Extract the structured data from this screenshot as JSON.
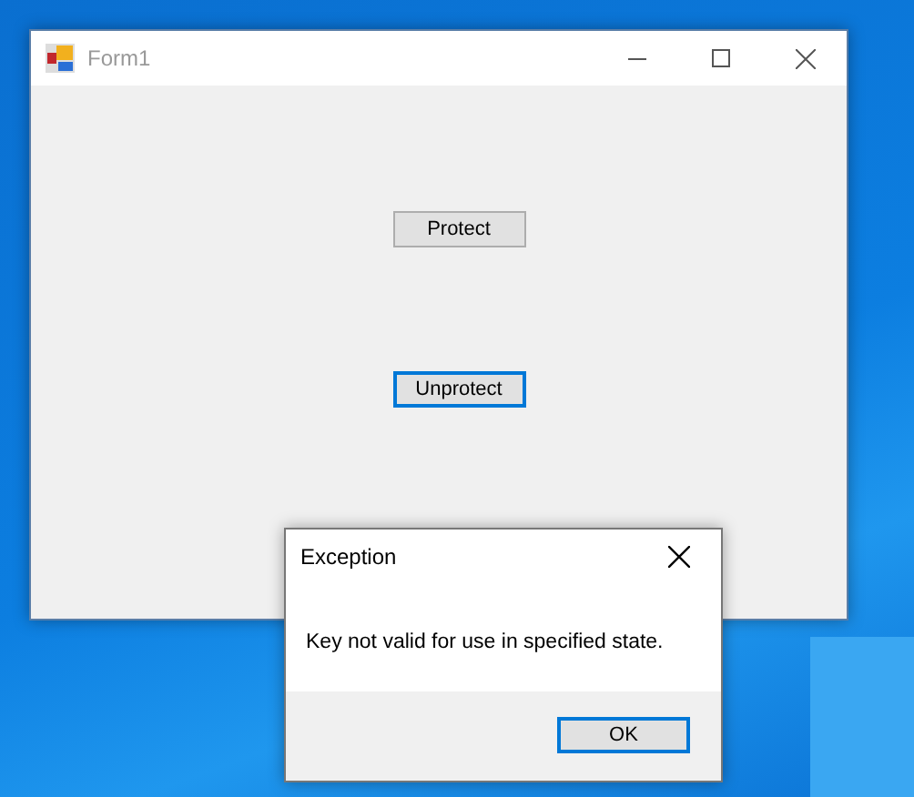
{
  "form_window": {
    "title": "Form1",
    "active": false,
    "buttons": [
      {
        "label": "Protect",
        "focused": false
      },
      {
        "label": "Unprotect",
        "focused": true
      }
    ]
  },
  "dialog": {
    "title": "Exception",
    "message": "Key not valid for use in specified state.",
    "buttons": [
      {
        "label": "OK",
        "focused": true
      }
    ]
  }
}
